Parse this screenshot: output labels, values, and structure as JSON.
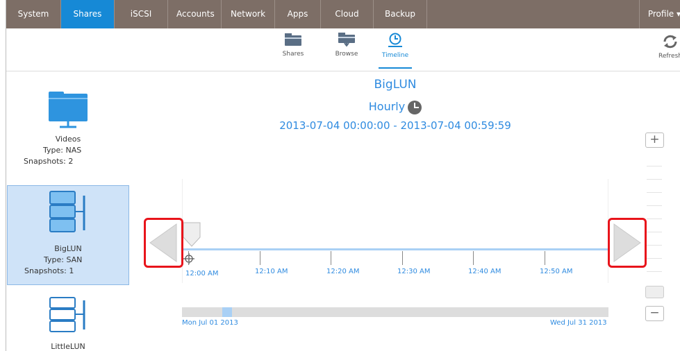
{
  "nav": {
    "tabs": [
      "System",
      "Shares",
      "iSCSI",
      "Accounts",
      "Network",
      "Apps",
      "Cloud",
      "Backup"
    ],
    "active_tab": "Shares",
    "profile_label": "Profile ▾"
  },
  "toolbar": {
    "shares_label": "Shares",
    "browse_label": "Browse",
    "timeline_label": "Timeline",
    "refresh_label": "Refresh",
    "active_tool": "Timeline"
  },
  "shares_list": [
    {
      "name": "Videos",
      "type": "Type: NAS",
      "snapshots": "Snapshots: 2",
      "icon": "folder-network-icon"
    },
    {
      "name": "BigLUN",
      "type": "Type: SAN",
      "snapshots": "Snapshots: 1",
      "icon": "lun-icon",
      "selected": true
    },
    {
      "name": "LittleLUN",
      "icon": "lun-icon"
    }
  ],
  "timeline": {
    "title": "BigLUN",
    "granularity": "Hourly",
    "range": "2013-07-04 00:00:00  -  2013-07-04 00:59:59",
    "ticks": [
      "12:00 AM",
      "12:10 AM",
      "12:20 AM",
      "12:30 AM",
      "12:40 AM",
      "12:50 AM"
    ],
    "scrub_start": "Mon Jul 01 2013",
    "scrub_end": "Wed Jul 31 2013"
  },
  "zoom": {
    "plus": "+",
    "minus": "−"
  },
  "colors": {
    "accent": "#1689d6",
    "nav_bg": "#7d6e66",
    "highlight": "#e8141b",
    "selected_bg": "#cfe3f8"
  }
}
